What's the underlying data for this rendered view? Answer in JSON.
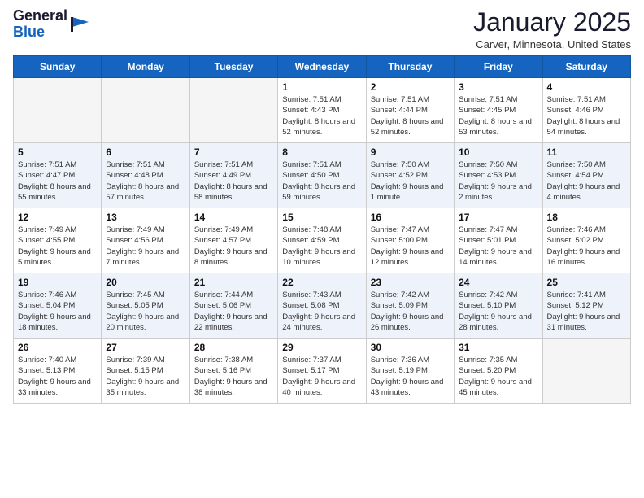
{
  "header": {
    "logo_general": "General",
    "logo_blue": "Blue",
    "month_title": "January 2025",
    "location": "Carver, Minnesota, United States"
  },
  "weekdays": [
    "Sunday",
    "Monday",
    "Tuesday",
    "Wednesday",
    "Thursday",
    "Friday",
    "Saturday"
  ],
  "weeks": [
    [
      {
        "day": "",
        "sunrise": "",
        "sunset": "",
        "daylight": "",
        "empty": true
      },
      {
        "day": "",
        "sunrise": "",
        "sunset": "",
        "daylight": "",
        "empty": true
      },
      {
        "day": "",
        "sunrise": "",
        "sunset": "",
        "daylight": "",
        "empty": true
      },
      {
        "day": "1",
        "sunrise": "Sunrise: 7:51 AM",
        "sunset": "Sunset: 4:43 PM",
        "daylight": "Daylight: 8 hours and 52 minutes.",
        "empty": false
      },
      {
        "day": "2",
        "sunrise": "Sunrise: 7:51 AM",
        "sunset": "Sunset: 4:44 PM",
        "daylight": "Daylight: 8 hours and 52 minutes.",
        "empty": false
      },
      {
        "day": "3",
        "sunrise": "Sunrise: 7:51 AM",
        "sunset": "Sunset: 4:45 PM",
        "daylight": "Daylight: 8 hours and 53 minutes.",
        "empty": false
      },
      {
        "day": "4",
        "sunrise": "Sunrise: 7:51 AM",
        "sunset": "Sunset: 4:46 PM",
        "daylight": "Daylight: 8 hours and 54 minutes.",
        "empty": false
      }
    ],
    [
      {
        "day": "5",
        "sunrise": "Sunrise: 7:51 AM",
        "sunset": "Sunset: 4:47 PM",
        "daylight": "Daylight: 8 hours and 55 minutes.",
        "empty": false
      },
      {
        "day": "6",
        "sunrise": "Sunrise: 7:51 AM",
        "sunset": "Sunset: 4:48 PM",
        "daylight": "Daylight: 8 hours and 57 minutes.",
        "empty": false
      },
      {
        "day": "7",
        "sunrise": "Sunrise: 7:51 AM",
        "sunset": "Sunset: 4:49 PM",
        "daylight": "Daylight: 8 hours and 58 minutes.",
        "empty": false
      },
      {
        "day": "8",
        "sunrise": "Sunrise: 7:51 AM",
        "sunset": "Sunset: 4:50 PM",
        "daylight": "Daylight: 8 hours and 59 minutes.",
        "empty": false
      },
      {
        "day": "9",
        "sunrise": "Sunrise: 7:50 AM",
        "sunset": "Sunset: 4:52 PM",
        "daylight": "Daylight: 9 hours and 1 minute.",
        "empty": false
      },
      {
        "day": "10",
        "sunrise": "Sunrise: 7:50 AM",
        "sunset": "Sunset: 4:53 PM",
        "daylight": "Daylight: 9 hours and 2 minutes.",
        "empty": false
      },
      {
        "day": "11",
        "sunrise": "Sunrise: 7:50 AM",
        "sunset": "Sunset: 4:54 PM",
        "daylight": "Daylight: 9 hours and 4 minutes.",
        "empty": false
      }
    ],
    [
      {
        "day": "12",
        "sunrise": "Sunrise: 7:49 AM",
        "sunset": "Sunset: 4:55 PM",
        "daylight": "Daylight: 9 hours and 5 minutes.",
        "empty": false
      },
      {
        "day": "13",
        "sunrise": "Sunrise: 7:49 AM",
        "sunset": "Sunset: 4:56 PM",
        "daylight": "Daylight: 9 hours and 7 minutes.",
        "empty": false
      },
      {
        "day": "14",
        "sunrise": "Sunrise: 7:49 AM",
        "sunset": "Sunset: 4:57 PM",
        "daylight": "Daylight: 9 hours and 8 minutes.",
        "empty": false
      },
      {
        "day": "15",
        "sunrise": "Sunrise: 7:48 AM",
        "sunset": "Sunset: 4:59 PM",
        "daylight": "Daylight: 9 hours and 10 minutes.",
        "empty": false
      },
      {
        "day": "16",
        "sunrise": "Sunrise: 7:47 AM",
        "sunset": "Sunset: 5:00 PM",
        "daylight": "Daylight: 9 hours and 12 minutes.",
        "empty": false
      },
      {
        "day": "17",
        "sunrise": "Sunrise: 7:47 AM",
        "sunset": "Sunset: 5:01 PM",
        "daylight": "Daylight: 9 hours and 14 minutes.",
        "empty": false
      },
      {
        "day": "18",
        "sunrise": "Sunrise: 7:46 AM",
        "sunset": "Sunset: 5:02 PM",
        "daylight": "Daylight: 9 hours and 16 minutes.",
        "empty": false
      }
    ],
    [
      {
        "day": "19",
        "sunrise": "Sunrise: 7:46 AM",
        "sunset": "Sunset: 5:04 PM",
        "daylight": "Daylight: 9 hours and 18 minutes.",
        "empty": false
      },
      {
        "day": "20",
        "sunrise": "Sunrise: 7:45 AM",
        "sunset": "Sunset: 5:05 PM",
        "daylight": "Daylight: 9 hours and 20 minutes.",
        "empty": false
      },
      {
        "day": "21",
        "sunrise": "Sunrise: 7:44 AM",
        "sunset": "Sunset: 5:06 PM",
        "daylight": "Daylight: 9 hours and 22 minutes.",
        "empty": false
      },
      {
        "day": "22",
        "sunrise": "Sunrise: 7:43 AM",
        "sunset": "Sunset: 5:08 PM",
        "daylight": "Daylight: 9 hours and 24 minutes.",
        "empty": false
      },
      {
        "day": "23",
        "sunrise": "Sunrise: 7:42 AM",
        "sunset": "Sunset: 5:09 PM",
        "daylight": "Daylight: 9 hours and 26 minutes.",
        "empty": false
      },
      {
        "day": "24",
        "sunrise": "Sunrise: 7:42 AM",
        "sunset": "Sunset: 5:10 PM",
        "daylight": "Daylight: 9 hours and 28 minutes.",
        "empty": false
      },
      {
        "day": "25",
        "sunrise": "Sunrise: 7:41 AM",
        "sunset": "Sunset: 5:12 PM",
        "daylight": "Daylight: 9 hours and 31 minutes.",
        "empty": false
      }
    ],
    [
      {
        "day": "26",
        "sunrise": "Sunrise: 7:40 AM",
        "sunset": "Sunset: 5:13 PM",
        "daylight": "Daylight: 9 hours and 33 minutes.",
        "empty": false
      },
      {
        "day": "27",
        "sunrise": "Sunrise: 7:39 AM",
        "sunset": "Sunset: 5:15 PM",
        "daylight": "Daylight: 9 hours and 35 minutes.",
        "empty": false
      },
      {
        "day": "28",
        "sunrise": "Sunrise: 7:38 AM",
        "sunset": "Sunset: 5:16 PM",
        "daylight": "Daylight: 9 hours and 38 minutes.",
        "empty": false
      },
      {
        "day": "29",
        "sunrise": "Sunrise: 7:37 AM",
        "sunset": "Sunset: 5:17 PM",
        "daylight": "Daylight: 9 hours and 40 minutes.",
        "empty": false
      },
      {
        "day": "30",
        "sunrise": "Sunrise: 7:36 AM",
        "sunset": "Sunset: 5:19 PM",
        "daylight": "Daylight: 9 hours and 43 minutes.",
        "empty": false
      },
      {
        "day": "31",
        "sunrise": "Sunrise: 7:35 AM",
        "sunset": "Sunset: 5:20 PM",
        "daylight": "Daylight: 9 hours and 45 minutes.",
        "empty": false
      },
      {
        "day": "",
        "sunrise": "",
        "sunset": "",
        "daylight": "",
        "empty": true
      }
    ]
  ],
  "colors": {
    "header_bg": "#1565c0",
    "stripe_odd": "#ffffff",
    "stripe_even": "#eef2fb",
    "empty_bg": "#f5f5f5"
  }
}
